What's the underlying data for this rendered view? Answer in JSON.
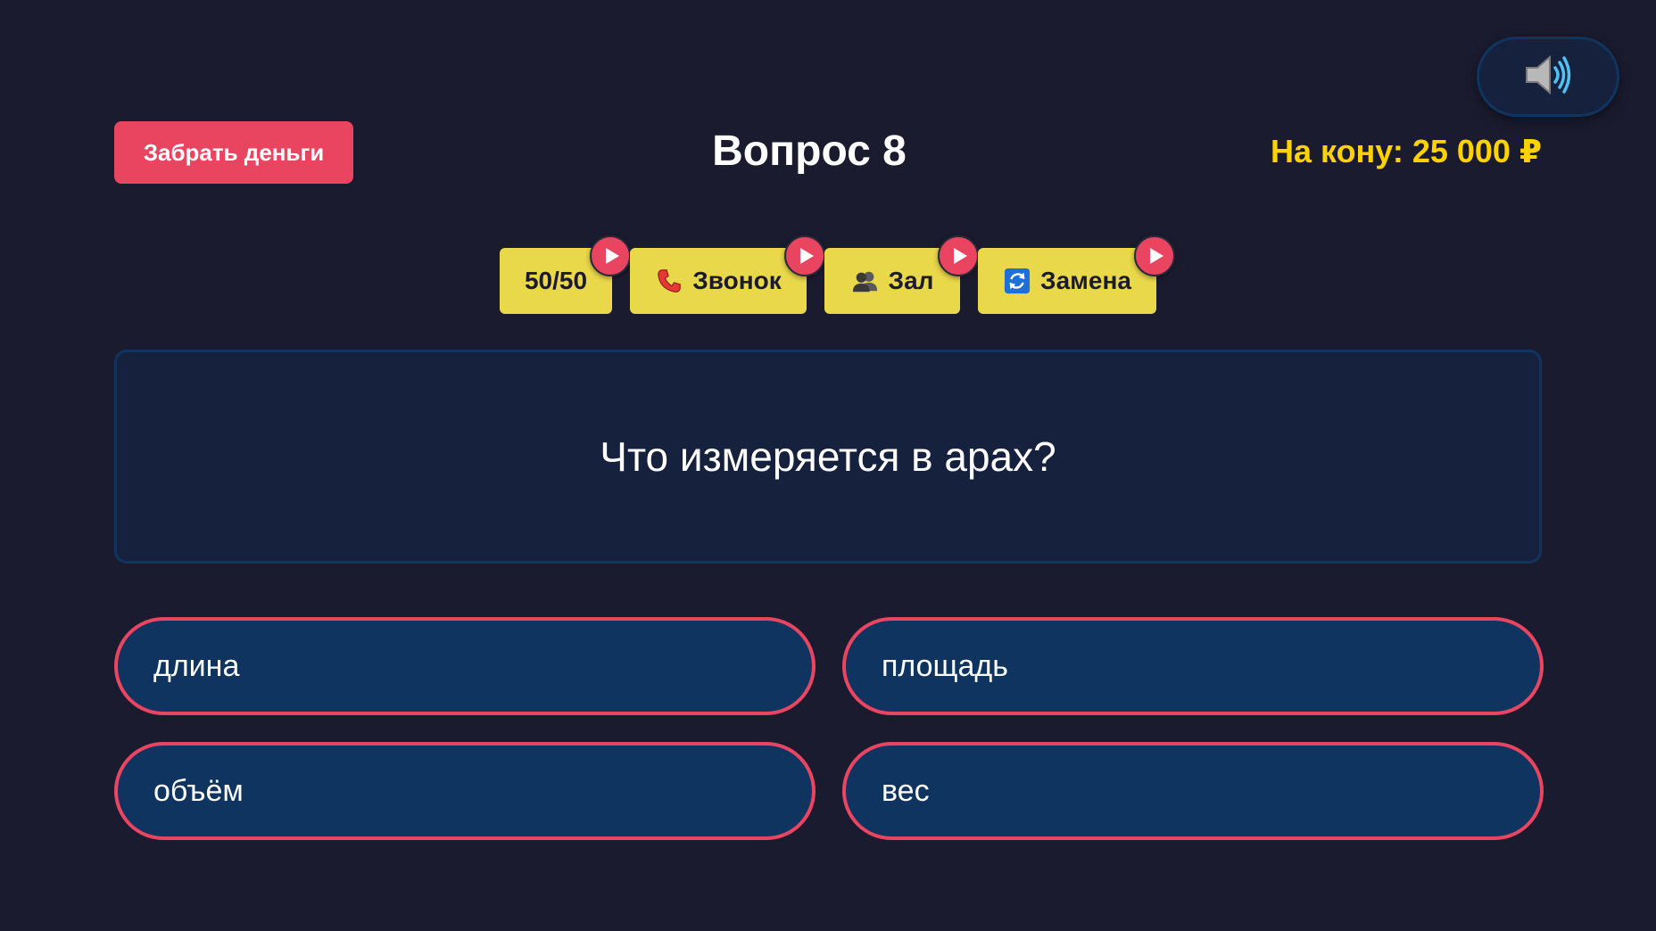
{
  "header": {
    "take_money_label": "Забрать деньги",
    "question_number": "Вопрос 8",
    "bank_label": "На кону: 25 000 ₽"
  },
  "sound": {
    "icon": "speaker-icon"
  },
  "lifelines": [
    {
      "label": "50/50",
      "icon": ""
    },
    {
      "label": "Звонок",
      "icon": "phone-icon"
    },
    {
      "label": "Зал",
      "icon": "audience-icon"
    },
    {
      "label": "Замена",
      "icon": "swap-icon"
    }
  ],
  "question": {
    "text": "Что измеряется в арах?"
  },
  "answers": [
    {
      "text": "длина"
    },
    {
      "text": "площадь"
    },
    {
      "text": "объём"
    },
    {
      "text": "вес"
    }
  ],
  "colors": {
    "background": "#1b1b2f",
    "accent": "#e94560",
    "panel": "#16213e",
    "answer_fill": "#0f3460",
    "bank_text": "#ffd200",
    "lifeline_fill": "#e9d84a"
  }
}
